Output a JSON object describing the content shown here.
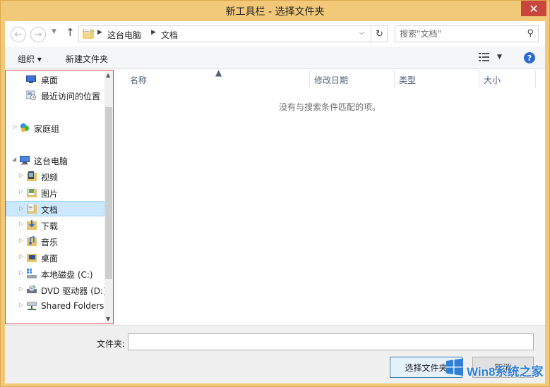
{
  "window": {
    "title": "新工具栏 - 选择文件夹",
    "close_label": "✕"
  },
  "address": {
    "path": [
      "这台电脑",
      "文档"
    ],
    "search_placeholder": "搜索\"文档\""
  },
  "toolbar": {
    "organize_label": "组织 ▾",
    "new_folder_label": "新建文件夹",
    "help_label": "?"
  },
  "nav": {
    "items": [
      {
        "label": "桌面",
        "icon": "desktop-icon"
      },
      {
        "label": "最近访问的位置",
        "icon": "recent-places-icon"
      },
      {
        "label": "家庭组",
        "icon": "homegroup-icon"
      },
      {
        "label": "这台电脑",
        "icon": "computer-icon"
      },
      {
        "label": "视频",
        "icon": "videos-folder-icon"
      },
      {
        "label": "图片",
        "icon": "pictures-folder-icon"
      },
      {
        "label": "文档",
        "icon": "documents-folder-icon"
      },
      {
        "label": "下载",
        "icon": "downloads-folder-icon"
      },
      {
        "label": "音乐",
        "icon": "music-folder-icon"
      },
      {
        "label": "桌面",
        "icon": "desktop-folder-icon"
      },
      {
        "label": "本地磁盘 (C:)",
        "icon": "local-disk-icon"
      },
      {
        "label": "DVD 驱动器 (D:)",
        "icon": "dvd-drive-icon"
      },
      {
        "label": "Shared Folders",
        "icon": "shared-folders-icon"
      }
    ],
    "selected": "文档"
  },
  "filelist": {
    "columns": [
      "名称",
      "修改日期",
      "类型",
      "大小"
    ],
    "empty_message": "没有与搜索条件匹配的项。"
  },
  "footer": {
    "folder_label": "文件夹:",
    "folder_value": "",
    "select_button": "选择文件夹",
    "cancel_button": "取消"
  },
  "watermark": {
    "text": "Win8系统之家"
  },
  "colors": {
    "frame": "#f2c879",
    "close": "#c9463d",
    "selection": "#cce8ff",
    "highlight_border": "#e04444",
    "accent": "#2b6bd0"
  }
}
